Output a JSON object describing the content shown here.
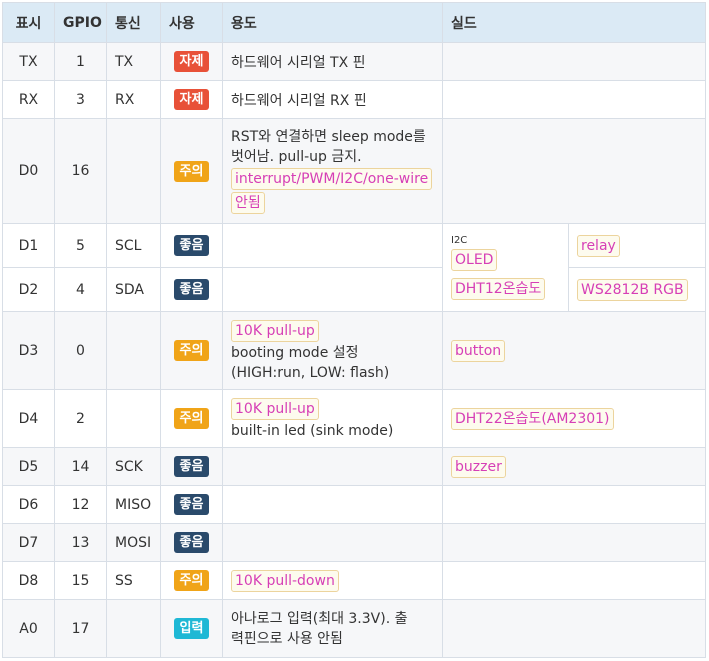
{
  "headers": {
    "label": "표시",
    "gpio": "GPIO",
    "comm": "통신",
    "use": "사용",
    "purpose": "용도",
    "shield": "실드"
  },
  "rows": {
    "tx": {
      "label": "TX",
      "gpio": "1",
      "comm": "TX",
      "badge": "자제",
      "purpose": "하드웨어 시리얼 TX 핀"
    },
    "rx": {
      "label": "RX",
      "gpio": "3",
      "comm": "RX",
      "badge": "자제",
      "purpose": "하드웨어 시리얼 RX 핀"
    },
    "d0": {
      "label": "D0",
      "gpio": "16",
      "comm": "",
      "badge": "주의",
      "purpose_1": "RST와 연결하면 sleep mode를",
      "purpose_2": "벗어남. pull-up 금지.",
      "code_1": "interrupt/PWM/I2C/one-wire",
      "code_2": "안됨"
    },
    "d1": {
      "label": "D1",
      "gpio": "5",
      "comm": "SCL",
      "badge": "좋음"
    },
    "d2": {
      "label": "D2",
      "gpio": "4",
      "comm": "SDA",
      "badge": "좋음"
    },
    "d3": {
      "label": "D3",
      "gpio": "0",
      "comm": "",
      "badge": "주의",
      "code": "10K pull-up",
      "purpose_1": "booting mode 설정",
      "purpose_2": "(HIGH:run, LOW: flash)",
      "shield": "button"
    },
    "d4": {
      "label": "D4",
      "gpio": "2",
      "comm": "",
      "badge": "주의",
      "code": "10K pull-up",
      "purpose": "built-in led (sink mode)",
      "shield": "DHT22온습도(AM2301)"
    },
    "d5": {
      "label": "D5",
      "gpio": "14",
      "comm": "SCK",
      "badge": "좋음",
      "shield": "buzzer"
    },
    "d6": {
      "label": "D6",
      "gpio": "12",
      "comm": "MISO",
      "badge": "좋음"
    },
    "d7": {
      "label": "D7",
      "gpio": "13",
      "comm": "MOSI",
      "badge": "좋음"
    },
    "d8": {
      "label": "D8",
      "gpio": "15",
      "comm": "SS",
      "badge": "주의",
      "code": "10K pull-down"
    },
    "a0": {
      "label": "A0",
      "gpio": "17",
      "comm": "",
      "badge": "입력",
      "purpose_1": "아나로그 입력(최대 3.3V). 출",
      "purpose_2": "력핀으로 사용 안됨"
    }
  },
  "shield_i2c": {
    "caption": "I2C",
    "oled": "OLED",
    "dht12": "DHT12온습도",
    "relay": "relay",
    "ws2812b": "WS2812B RGB"
  },
  "badge_colors": {
    "avoid": "#e85138",
    "caution": "#f0a418",
    "good": "#2a4a6b",
    "input": "#1fb8d5"
  }
}
